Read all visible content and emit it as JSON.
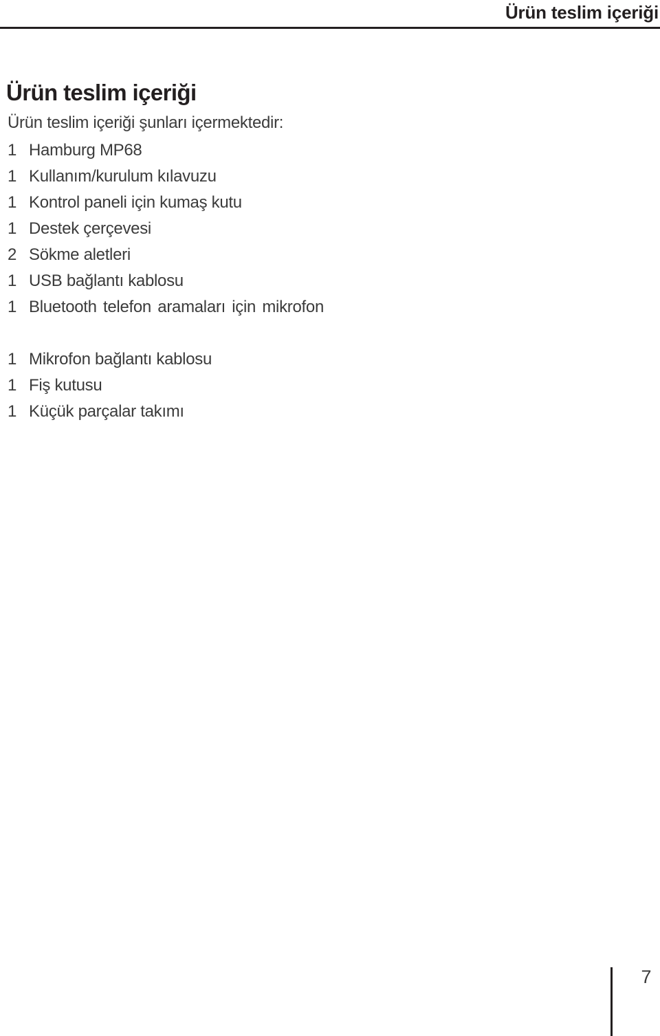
{
  "header": {
    "running_title": "Ürün teslim içeriği"
  },
  "main": {
    "title": "Ürün teslim içeriği",
    "intro": "Ürün teslim içeriği şunları içermektedir:",
    "items": [
      {
        "qty": "1",
        "label": "Hamburg MP68"
      },
      {
        "qty": "1",
        "label": "Kullanım/kurulum kılavuzu"
      },
      {
        "qty": "1",
        "label": "Kontrol paneli için kumaş kutu"
      },
      {
        "qty": "1",
        "label": "Destek çerçevesi"
      },
      {
        "qty": "2",
        "label": "Sökme aletleri"
      },
      {
        "qty": "1",
        "label": "USB bağlantı kablosu"
      },
      {
        "qty": "1",
        "label": "Bluetooth telefon aramaları için mikrofon"
      },
      {
        "qty": "1",
        "label": "Mikrofon bağlantı kablosu"
      },
      {
        "qty": "1",
        "label": "Fiş kutusu"
      },
      {
        "qty": "1",
        "label": "Küçük parçalar takımı"
      }
    ]
  },
  "footer": {
    "page_number": "7"
  },
  "colors": {
    "ink": "#231f20",
    "body_text": "#3b3b3b",
    "background": "#ffffff"
  }
}
